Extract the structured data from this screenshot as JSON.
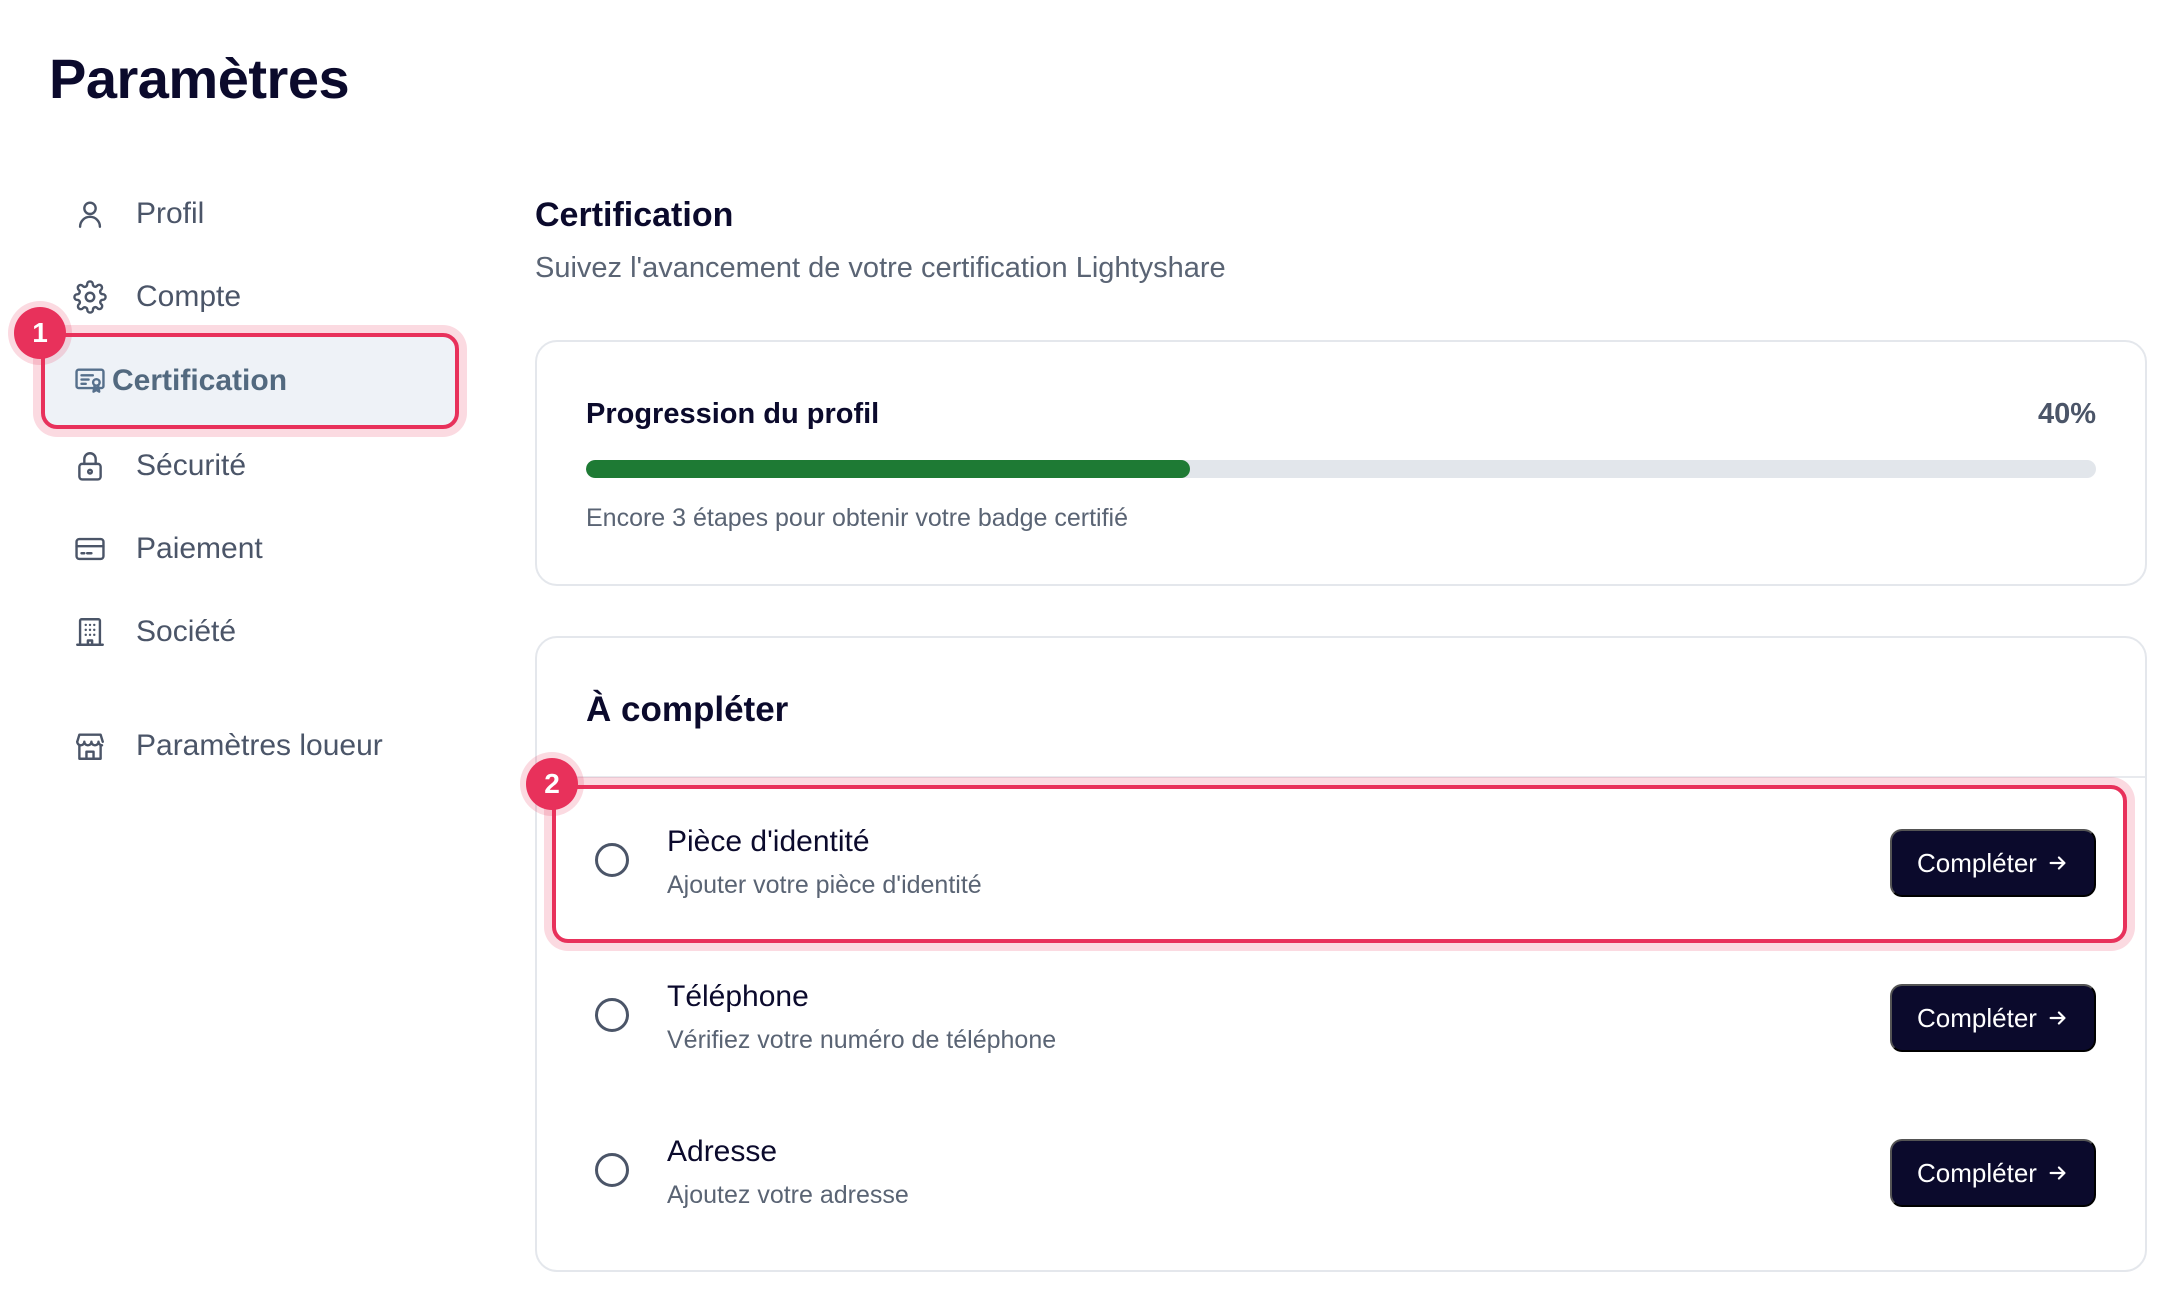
{
  "page": {
    "title": "Paramètres"
  },
  "sidebar": {
    "items": [
      {
        "label": "Profil",
        "icon": "user-icon"
      },
      {
        "label": "Compte",
        "icon": "gear-icon"
      },
      {
        "label": "Certification",
        "icon": "certificate-icon",
        "active": true
      },
      {
        "label": "Sécurité",
        "icon": "lock-icon"
      },
      {
        "label": "Paiement",
        "icon": "credit-card-icon"
      },
      {
        "label": "Société",
        "icon": "building-icon"
      },
      {
        "label": "Paramètres loueur",
        "icon": "store-icon"
      }
    ]
  },
  "annotations": {
    "marker1": "1",
    "marker2": "2",
    "color": "#e8315b"
  },
  "main": {
    "title": "Certification",
    "subtitle": "Suivez l'avancement de votre certification Lightyshare",
    "progress": {
      "label": "Progression du profil",
      "percent_text": "40%",
      "value": 0.4,
      "hint": "Encore 3 étapes pour obtenir votre badge certifié",
      "fill_color": "#1e7a34"
    },
    "todo": {
      "title": "À compléter",
      "tasks": [
        {
          "title": "Pièce d'identité",
          "subtitle": "Ajouter votre pièce d'identité",
          "button": "Compléter"
        },
        {
          "title": "Téléphone",
          "subtitle": "Vérifiez votre numéro de téléphone",
          "button": "Compléter"
        },
        {
          "title": "Adresse",
          "subtitle": "Ajoutez votre adresse",
          "button": "Compléter"
        }
      ]
    }
  }
}
